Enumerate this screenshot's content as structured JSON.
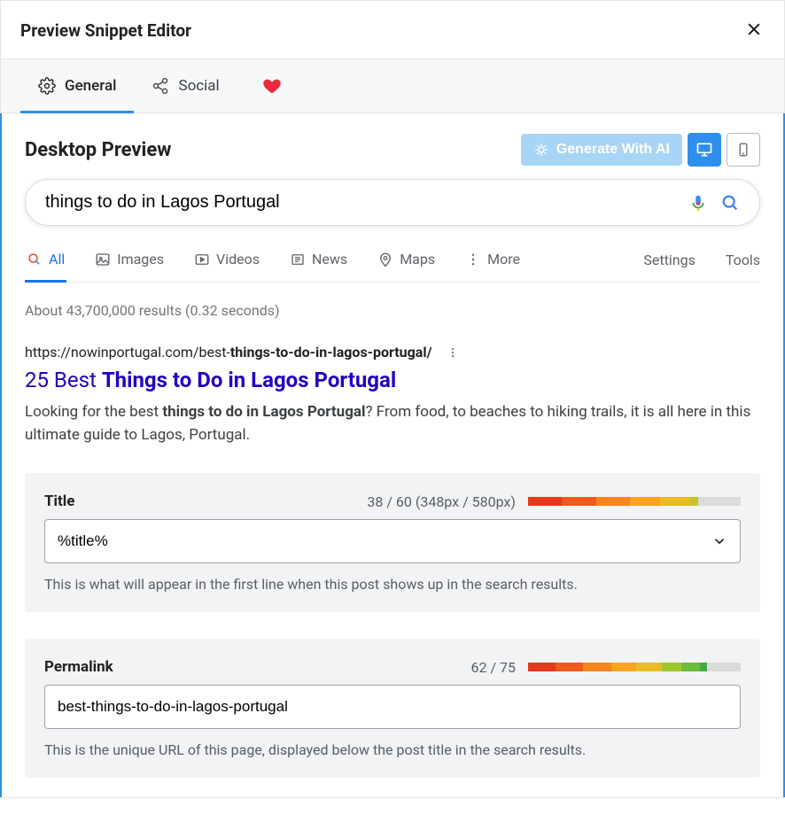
{
  "header": {
    "title": "Preview Snippet Editor"
  },
  "tabs": {
    "general": "General",
    "social": "Social"
  },
  "preview": {
    "heading": "Desktop Preview",
    "ai_button": "Generate With AI"
  },
  "search": {
    "query": "things to do in Lagos Portugal",
    "tabs": {
      "all": "All",
      "images": "Images",
      "videos": "Videos",
      "news": "News",
      "maps": "Maps",
      "more": "More"
    },
    "right": {
      "settings": "Settings",
      "tools": "Tools"
    },
    "results_text": "About 43,700,000 results (0.32 seconds)"
  },
  "snippet": {
    "url_plain": "https://nowinportugal.com/best-",
    "url_bold": "things-to-do-in-lagos-portugal/",
    "title_plain": "25 Best ",
    "title_bold": "Things to Do in Lagos Portugal",
    "desc_before": "Looking for the best ",
    "desc_bold": "things to do in Lagos Portugal",
    "desc_after": "? From food, to beaches to hiking trails, it is all here in this ultimate guide to Lagos, Portugal."
  },
  "title_panel": {
    "label": "Title",
    "counter": "38 / 60 (348px / 580px)",
    "value": "%title%",
    "help": "This is what will appear in the first line when this post shows up in the search results.",
    "bar": [
      {
        "color": "#e8381b",
        "w": 16
      },
      {
        "color": "#f05a1e",
        "w": 16
      },
      {
        "color": "#f7861f",
        "w": 16
      },
      {
        "color": "#f9a41e",
        "w": 14
      },
      {
        "color": "#e9bd21",
        "w": 14
      },
      {
        "color": "#c3c524",
        "w": 4
      },
      {
        "color": "#d9dbdd",
        "w": 20
      }
    ]
  },
  "permalink_panel": {
    "label": "Permalink",
    "counter": "62 / 75",
    "value": "best-things-to-do-in-lagos-portugal",
    "help": "This is the unique URL of this page, displayed below the post title in the search results.",
    "bar": [
      {
        "color": "#e8381b",
        "w": 13
      },
      {
        "color": "#f05a1e",
        "w": 13
      },
      {
        "color": "#f7861f",
        "w": 13
      },
      {
        "color": "#f9a41e",
        "w": 12
      },
      {
        "color": "#e9bd21",
        "w": 12
      },
      {
        "color": "#a0c72a",
        "w": 9
      },
      {
        "color": "#6dbb3c",
        "w": 9
      },
      {
        "color": "#46a748",
        "w": 3
      },
      {
        "color": "#d9dbdd",
        "w": 16
      }
    ]
  }
}
